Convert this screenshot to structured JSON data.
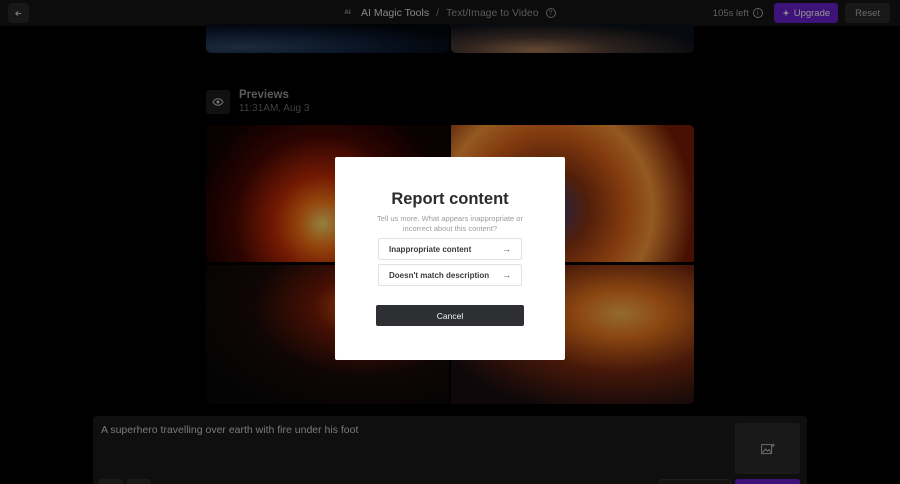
{
  "header": {
    "ai_badge": "AI",
    "tool_name": "AI Magic Tools",
    "separator": "/",
    "page_name": "Text/Image to Video",
    "credits": "105s left",
    "upgrade_label": "Upgrade",
    "reset_label": "Reset"
  },
  "previews": {
    "title": "Previews",
    "timestamp": "11:31AM, Aug 3"
  },
  "modal": {
    "title": "Report content",
    "description": "Tell us more. What appears inappropriate or incorrect about this content?",
    "options": [
      {
        "label": "Inappropriate content"
      },
      {
        "label": "Doesn't match description"
      }
    ],
    "cancel_label": "Cancel"
  },
  "prompt": {
    "text": "A superhero travelling over earth with fire under his foot"
  },
  "colors": {
    "accent": "#6a1fd0",
    "background": "#000000",
    "topbar": "#151515"
  },
  "icons": [
    "back-arrow-icon",
    "help-icon",
    "info-icon",
    "sparkle-icon",
    "eye-icon",
    "arrow-right-icon",
    "image-add-icon"
  ]
}
